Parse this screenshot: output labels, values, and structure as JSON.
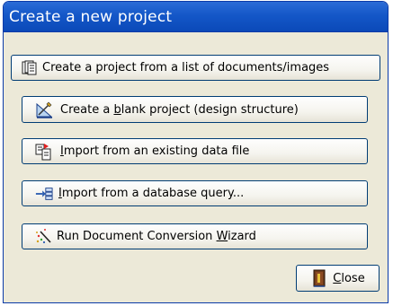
{
  "dialog": {
    "title": "Create a new project"
  },
  "buttons": [
    {
      "id": "from-list",
      "label": "Create a project from a list of documents/images",
      "icon": "documents-stack-icon"
    },
    {
      "id": "blank",
      "label_pre": "Create a ",
      "label_mnemonic": "b",
      "label_post": "lank project (design structure)",
      "icon": "design-ruler-icon"
    },
    {
      "id": "import-file",
      "label_pre": "",
      "label_mnemonic": "I",
      "label_post": "mport from an existing data file",
      "icon": "import-file-icon"
    },
    {
      "id": "import-db",
      "label_pre": "",
      "label_mnemonic": "I",
      "label_post": "mport from a database query...",
      "icon": "database-query-icon"
    },
    {
      "id": "wizard",
      "label_pre": "Run Document Conversion ",
      "label_mnemonic": "W",
      "label_post": "izard",
      "icon": "wizard-wand-icon"
    }
  ],
  "close": {
    "label_mnemonic": "C",
    "label_post": "lose",
    "icon": "door-exit-icon"
  }
}
